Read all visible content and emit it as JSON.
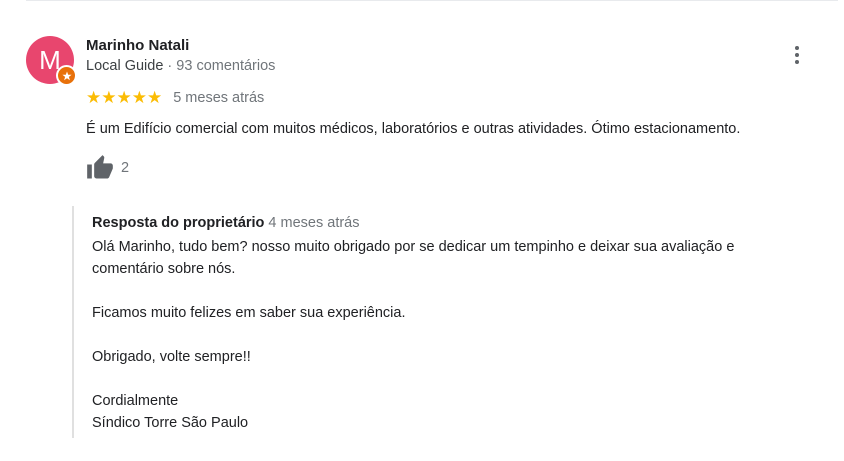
{
  "review": {
    "author_name": "Marinho Natali",
    "avatar_letter": "M",
    "author_badge": "Local Guide",
    "meta_separator": " · ",
    "comment_count": "93 comentários",
    "rating": 5,
    "stars": "★★★★★",
    "time_ago": "5 meses atrás",
    "text": "É um Edifício comercial com muitos médicos, laboratórios e outras atividades. Ótimo estacionamento.",
    "likes": "2"
  },
  "owner_response": {
    "title": "Resposta do proprietário",
    "time_ago": "4 meses atrás",
    "line1": "Olá Marinho, tudo bem? nosso muito obrigado por se dedicar um tempinho e deixar sua avaliação e",
    "line2": "comentário sobre nós.",
    "line3": "Ficamos muito felizes em saber sua experiência.",
    "line4": "Obrigado, volte sempre!!",
    "line5": "Cordialmente",
    "line6": "Síndico Torre São Paulo"
  },
  "colors": {
    "avatar_bg": "#e8466e",
    "badge_bg": "#e8710a",
    "star": "#fbbc04",
    "muted_text": "#70757a",
    "icon": "#5f6368"
  },
  "icons": {
    "more": "more-vert-icon",
    "like": "thumb-up-icon",
    "badge": "local-guide-star-icon"
  }
}
